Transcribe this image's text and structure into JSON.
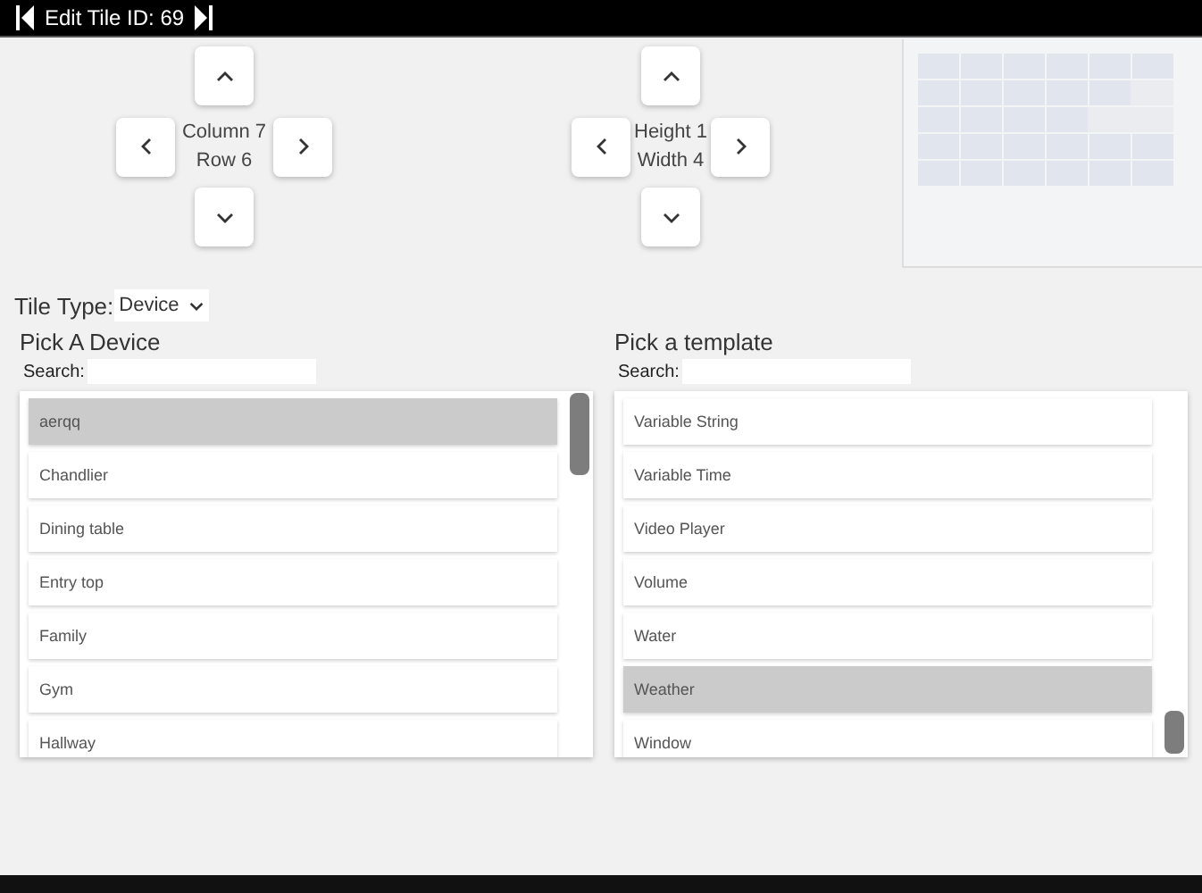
{
  "title_bar": {
    "title": "Edit Tile ID: 69"
  },
  "position": {
    "line_1": "Column 7",
    "line_2": "Row 6"
  },
  "size": {
    "line_1": "Height 1",
    "line_2": "Width 4"
  },
  "preview_grid": {
    "rows": [
      {
        "level": 1
      },
      {
        "level": 0.8333
      },
      {
        "level": 0.6667
      },
      {
        "level": 1
      },
      {
        "level": 1
      }
    ]
  },
  "tile_type": {
    "label": "Tile Type:",
    "value": "Device"
  },
  "pickers": [
    {
      "heading": "Pick A Device",
      "search_label": "Search:",
      "scrolled_to_end": false,
      "items": [
        {
          "label": "aerqq",
          "selected": true
        },
        {
          "label": "Chandlier",
          "selected": false
        },
        {
          "label": "Dining table",
          "selected": false
        },
        {
          "label": "Entry top",
          "selected": false
        },
        {
          "label": "Family",
          "selected": false
        },
        {
          "label": "Gym",
          "selected": false
        },
        {
          "label": "Hallway",
          "selected": false
        }
      ]
    },
    {
      "heading": "Pick a template",
      "search_label": "Search:",
      "scrolled_to_end": true,
      "items": [
        {
          "label": "Variable String",
          "selected": false
        },
        {
          "label": "Variable Time",
          "selected": false
        },
        {
          "label": "Video Player",
          "selected": false
        },
        {
          "label": "Volume",
          "selected": false
        },
        {
          "label": "Water",
          "selected": false
        },
        {
          "label": "Weather",
          "selected": true
        },
        {
          "label": "Window",
          "selected": false
        }
      ]
    }
  ]
}
